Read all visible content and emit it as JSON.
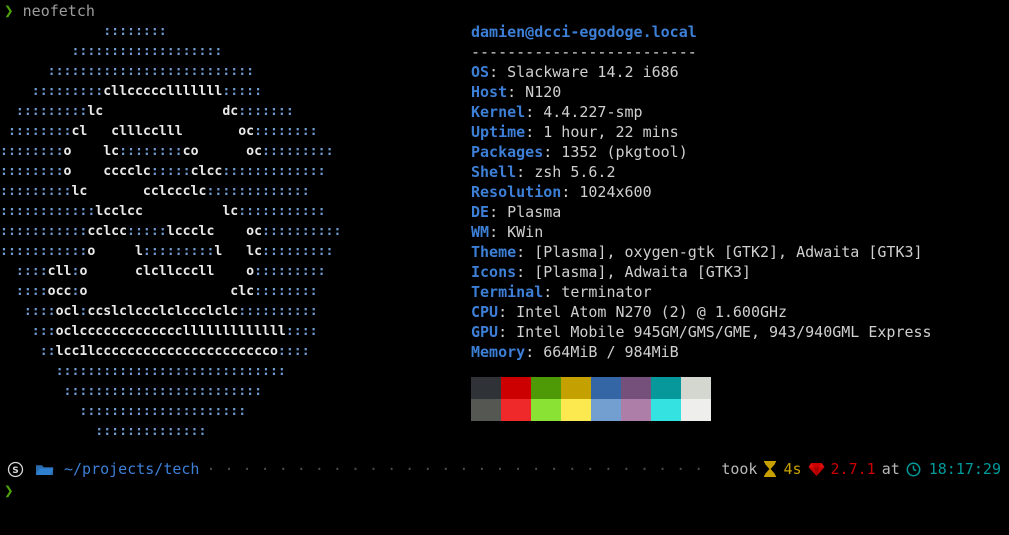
{
  "command_line": {
    "prompt_symbol": "❯",
    "command": "neofetch"
  },
  "ascii_art": {
    "name": "slackware-logo-ascii",
    "lines": [
      "             ::::::::",
      "         :::::::::::::::::::",
      "      ::::::::::::::::::::::::::",
      "    :::::::::cllccccclllllll:::::",
      "  :::::::::lc               dc:::::::",
      " ::::::::cl   clllcclll       oc::::::::",
      "::::::::o    lc::::::::co      oc:::::::::",
      "::::::::o    cccclc:::::clcc:::::::::::::",
      ":::::::::lc       cclccclc:::::::::::::",
      "::::::::::::lcclcc          lc:::::::::::",
      ":::::::::::cclcc:::::lccclc    oc::::::::::",
      ":::::::::::o     l:::::::::l   lc:::::::::",
      "  ::::cll:o      clcllcccll    o:::::::::",
      "  ::::occ:o                  clc::::::::",
      "   ::::ocl:ccslclccclclccclclc::::::::::",
      "    :::oclccccccccccccclllllllllllll::::",
      "     ::lcc1lcccccccccccccccccccccco::::",
      "       :::::::::::::::::::::::::::::",
      "        :::::::::::::::::::::::::",
      "          :::::::::::::::::::::",
      "            ::::::::::::::"
    ],
    "dot_color": "#6f9bd1",
    "glyph_color": "#e9e9e9"
  },
  "info": {
    "title": "damien@dcci-egodoge.local",
    "rule": "-------------------------",
    "entries": [
      {
        "key": "OS",
        "value": "Slackware 14.2 i686"
      },
      {
        "key": "Host",
        "value": "N120"
      },
      {
        "key": "Kernel",
        "value": "4.4.227-smp"
      },
      {
        "key": "Uptime",
        "value": "1 hour, 22 mins"
      },
      {
        "key": "Packages",
        "value": "1352 (pkgtool)"
      },
      {
        "key": "Shell",
        "value": "zsh 5.6.2"
      },
      {
        "key": "Resolution",
        "value": "1024x600"
      },
      {
        "key": "DE",
        "value": "Plasma"
      },
      {
        "key": "WM",
        "value": "KWin"
      },
      {
        "key": "Theme",
        "value": "[Plasma], oxygen-gtk [GTK2], Adwaita [GTK3]"
      },
      {
        "key": "Icons",
        "value": "[Plasma], Adwaita [GTK3]"
      },
      {
        "key": "Terminal",
        "value": "terminator"
      },
      {
        "key": "CPU",
        "value": "Intel Atom N270 (2) @ 1.600GHz"
      },
      {
        "key": "GPU",
        "value": "Intel Mobile 945GM/GMS/GME, 943/940GML Express"
      },
      {
        "key": "Memory",
        "value": "664MiB / 984MiB"
      }
    ],
    "key_color": "#3d7fd6",
    "value_color": "#cfcfcf"
  },
  "palette": {
    "normal": [
      "#2f3337",
      "#cc0000",
      "#4e9a06",
      "#c4a000",
      "#3465a4",
      "#75507b",
      "#06989a",
      "#d3d7cf"
    ],
    "bright": [
      "#555753",
      "#ef2929",
      "#8ae234",
      "#fce94f",
      "#729fcf",
      "#ad7fa8",
      "#34e2e2",
      "#eeeeec"
    ]
  },
  "statusbar": {
    "distro_icon": "slackware-icon",
    "distro_glyph": "Ⓢ",
    "folder_icon": "folder-icon",
    "path": "~/projects/tech",
    "separator_dots": "· · · · · · · · · · · · · · · · · · · · · · · · · · · · · · · · · · · · · · · · · · · · · · · · · · · · ·",
    "took_label": "took",
    "hourglass_icon": "hourglass-icon",
    "duration": "4s",
    "gem_icon": "gem-icon",
    "version": "2.7.1",
    "at_label": "at",
    "clock_icon": "clock-icon",
    "time": "18:17:29",
    "colors": {
      "path": "#3d7fd6",
      "duration": "#c7a000",
      "version": "#cc0000",
      "time": "#009a9a",
      "label": "#b9b9b9",
      "dots": "#4a4a4a"
    }
  },
  "bottom_prompt": {
    "prompt_symbol": "❯"
  }
}
